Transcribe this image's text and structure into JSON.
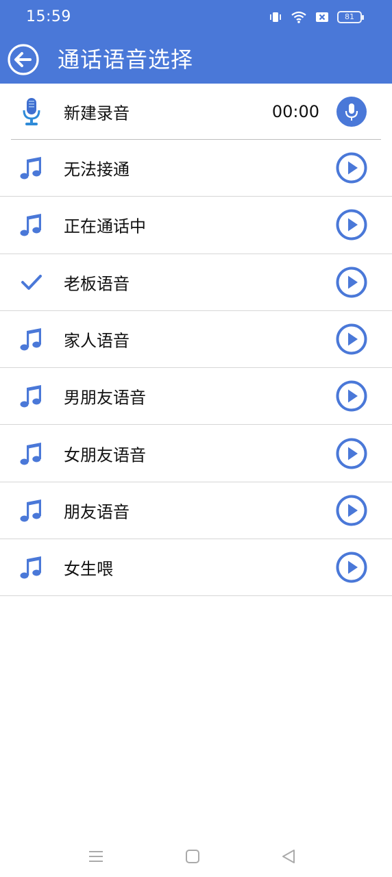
{
  "status_bar": {
    "time": "15:59",
    "battery": "81",
    "icons": [
      "vibrate-icon",
      "wifi-icon",
      "sim-x-icon",
      "battery-icon"
    ]
  },
  "app_bar": {
    "title": "通话语音选择",
    "back_icon": "back-arrow-icon"
  },
  "record": {
    "label": "新建录音",
    "duration": "00:00",
    "left_icon": "microphone-icon",
    "button_icon": "record-mic-icon"
  },
  "voices": [
    {
      "label": "无法接通",
      "icon": "music-note-icon",
      "selected": false
    },
    {
      "label": "正在通话中",
      "icon": "music-note-icon",
      "selected": false
    },
    {
      "label": "老板语音",
      "icon": "checkmark-icon",
      "selected": true
    },
    {
      "label": "家人语音",
      "icon": "music-note-icon",
      "selected": false
    },
    {
      "label": "男朋友语音",
      "icon": "music-note-icon",
      "selected": false
    },
    {
      "label": "女朋友语音",
      "icon": "music-note-icon",
      "selected": false
    },
    {
      "label": "朋友语音",
      "icon": "music-note-icon",
      "selected": false
    },
    {
      "label": "女生喂",
      "icon": "music-note-icon",
      "selected": false
    }
  ],
  "nav_bar": [
    "menu-icon",
    "home-icon",
    "back-triangle-icon"
  ],
  "colors": {
    "primary": "#4a78d8",
    "divider": "#d6d6d6",
    "text": "#111111"
  }
}
